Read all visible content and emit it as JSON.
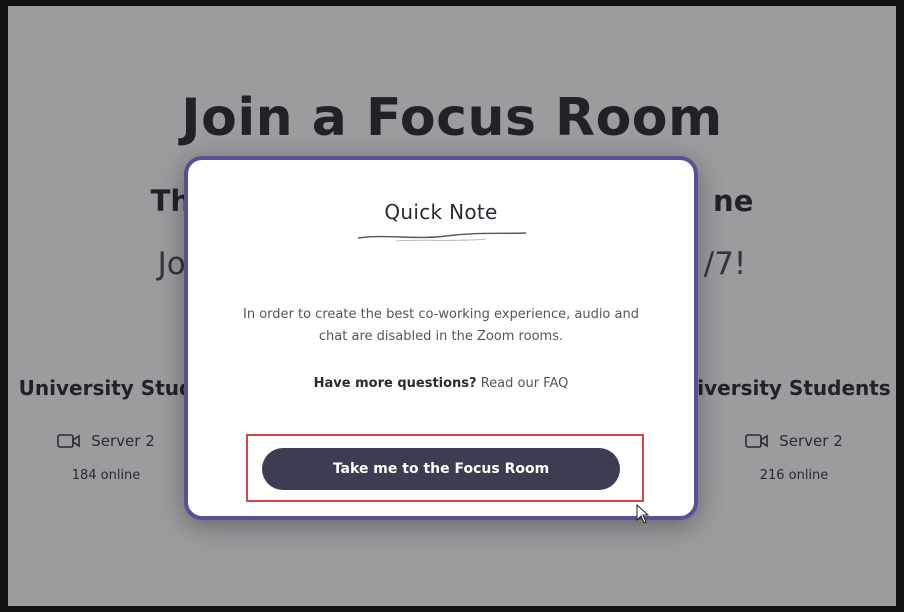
{
  "page": {
    "title": "Join a Focus Room",
    "subtitle_left": "Th",
    "subtitle_right": "ne",
    "tagline_left": "Jo",
    "tagline_right": "/7!"
  },
  "rooms": [
    {
      "name": "University Stud",
      "server": "Server 2",
      "online": "184 online",
      "icon": "video-camera-icon"
    },
    {
      "name": "iversity Students",
      "server": "Server 2",
      "online": "216 online",
      "icon": "video-camera-icon"
    }
  ],
  "modal": {
    "title": "Quick Note",
    "body": "In order to create the best co-working experience, audio and chat are disabled in the Zoom rooms.",
    "faq_question": "Have more questions?",
    "faq_link": "Read our FAQ",
    "cta_label": "Take me to the Focus Room"
  },
  "colors": {
    "modal_border": "#5a4f98",
    "button_bg": "#3c3d52",
    "highlight": "#d64545"
  }
}
